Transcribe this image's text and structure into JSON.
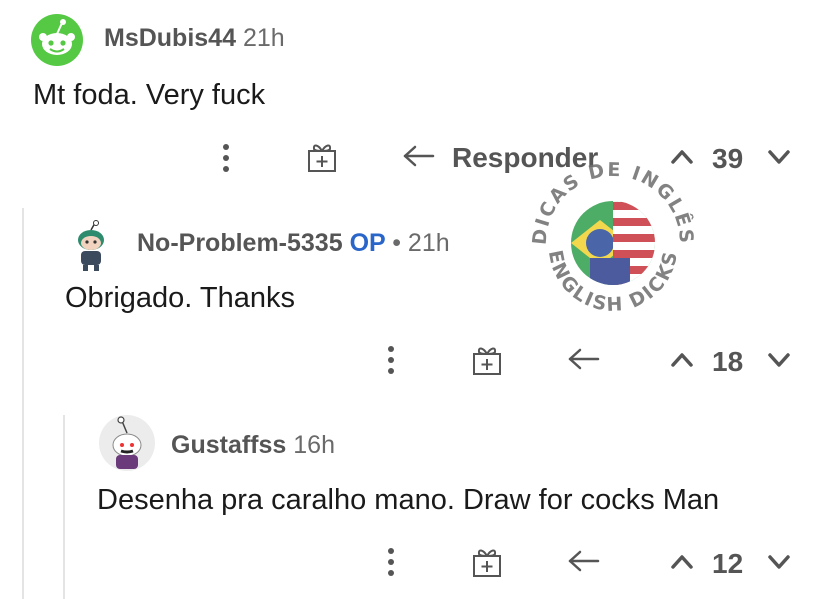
{
  "comments": [
    {
      "username": "MsDubis44",
      "time": "21h",
      "text": "Mt foda. Very fuck",
      "reply_label": "Responder",
      "score": "39",
      "avatar_color": "#55c944"
    },
    {
      "username": "No-Problem-5335",
      "op_badge": "OP",
      "separator": "•",
      "time": "21h",
      "text": "Obrigado. Thanks",
      "score": "18"
    },
    {
      "username": "Gustaffss",
      "time": "16h",
      "text": "Desenha pra caralho mano. Draw for cocks Man",
      "score": "12"
    }
  ],
  "watermark": {
    "top_text": "DICAS DE INGLÊS",
    "bottom_text": "ENGLISH DICKS"
  },
  "icons": {
    "more": "more-options-icon",
    "award": "award-gift-icon",
    "reply": "reply-arrow-icon",
    "upvote": "upvote-icon",
    "downvote": "downvote-icon"
  },
  "colors": {
    "op": "#2a66c9",
    "meta": "#555555",
    "avatar_green": "#55c944"
  }
}
